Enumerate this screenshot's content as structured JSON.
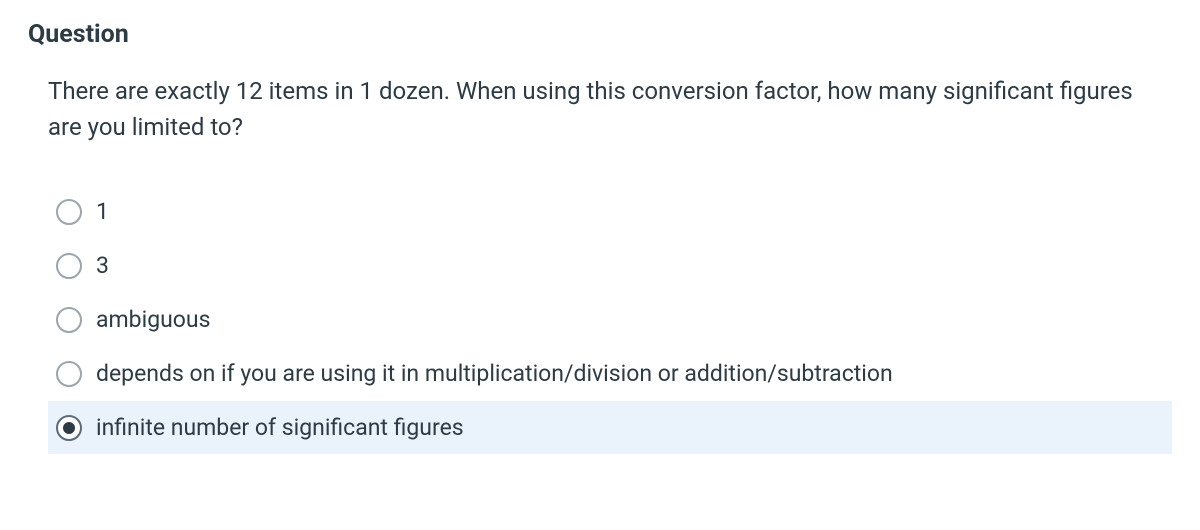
{
  "header": "Question",
  "question_text": "There are exactly 12 items in 1 dozen. When using this conversion factor, how many significant figures are you limited to?",
  "options": [
    {
      "label": "1",
      "selected": false
    },
    {
      "label": "3",
      "selected": false
    },
    {
      "label": "ambiguous",
      "selected": false
    },
    {
      "label": "depends on if you are using it in multiplication/division or addition/subtraction",
      "selected": false
    },
    {
      "label": "infinite number of significant figures",
      "selected": true
    }
  ]
}
